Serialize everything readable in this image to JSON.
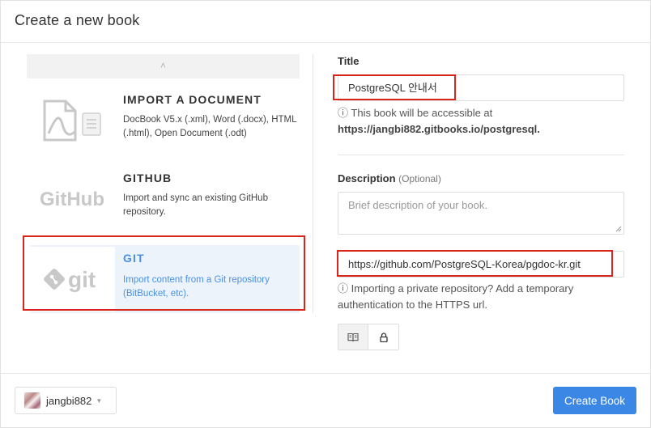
{
  "dialog": {
    "title": "Create a new book"
  },
  "sources": {
    "scroll_up": "˄",
    "items": [
      {
        "title": "IMPORT A DOCUMENT",
        "desc": "DocBook V5.x (.xml), Word (.docx), HTML (.html), Open Document (.odt)",
        "icon": "document-icon"
      },
      {
        "title": "GITHUB",
        "desc": "Import and sync an existing GitHub repository.",
        "icon": "github-logo",
        "logo_text": "GitHub"
      },
      {
        "title": "GIT",
        "desc": "Import content from a Git repository (BitBucket, etc).",
        "icon": "git-logo",
        "logo_text": "git",
        "selected": true
      }
    ]
  },
  "form": {
    "title_label": "Title",
    "title_value": "PostgreSQL 안내서",
    "url_help_prefix": "This book will be accessible at",
    "url": "https://jangbi882.gitbooks.io/postgresql.",
    "description_label": "Description",
    "description_optional": "(Optional)",
    "description_placeholder": "Brief description of your book.",
    "git_url": "https://github.com/PostgreSQL-Korea/pgdoc-kr.git",
    "git_help": "Importing a private repository? Add a temporary authentication to the HTTPS url."
  },
  "footer": {
    "owner": "jangbi882",
    "create_button": "Create Book"
  },
  "colors": {
    "accent": "#3b87e6",
    "highlight": "#d9261c",
    "selected_bg": "#edf3fb"
  }
}
